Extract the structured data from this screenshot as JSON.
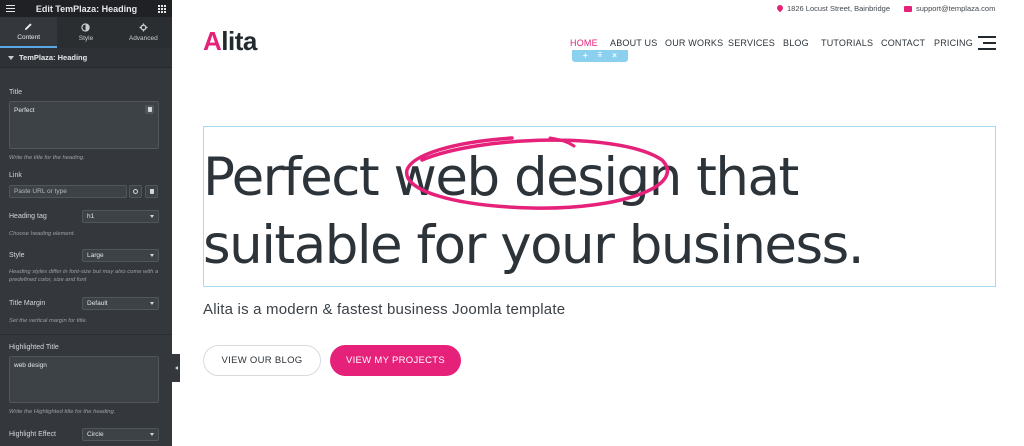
{
  "editor": {
    "header_title": "Edit TemPlaza: Heading",
    "tabs": [
      {
        "label": "Content",
        "icon": "pencil-icon"
      },
      {
        "label": "Style",
        "icon": "half-circle-icon"
      },
      {
        "label": "Advanced",
        "icon": "gear-icon"
      }
    ],
    "section_title": "TemPlaza: Heading",
    "title_label": "Title",
    "title_value": "Perfect",
    "title_help": "Write the title for the heading.",
    "link_label": "Link",
    "link_placeholder": "Paste URL or type",
    "heading_tag_label": "Heading tag",
    "heading_tag_value": "h1",
    "heading_tag_help": "Choose heading element.",
    "style_label": "Style",
    "style_value": "Large",
    "style_help": "Heading styles differ in font-size but may also come with a predefined color, size and font",
    "title_margin_label": "Title Margin",
    "title_margin_value": "Default",
    "title_margin_help": "Set the vertical margin for title.",
    "highlighted_title_label": "Highlighted Title",
    "highlighted_title_value": "web design",
    "highlighted_title_help": "Write the Highlighted title for the heading.",
    "highlight_effect_label": "Highlight Effect",
    "highlight_effect_value": "Circle"
  },
  "site": {
    "address": "1826 Locust Street, Bainbridge",
    "email": "support@templaza.com",
    "logo_first": "A",
    "logo_rest": "lita",
    "nav": [
      "HOME",
      "ABOUT US",
      "OUR WORKS",
      "SERVICES",
      "BLOG",
      "TUTORIALS",
      "CONTACT",
      "PRICING"
    ],
    "heading_prefix": "Perfect ",
    "heading_highlight": "web design",
    "heading_suffix": " that",
    "heading_line2": "suitable for your business.",
    "subtitle": "Alita is a modern & fastest business Joomla template",
    "btn_blog": "VIEW OUR BLOG",
    "btn_projects": "VIEW MY PROJECTS",
    "colors": {
      "accent": "#e5217a",
      "text": "#2c343a",
      "selection": "#a8daf0"
    }
  }
}
